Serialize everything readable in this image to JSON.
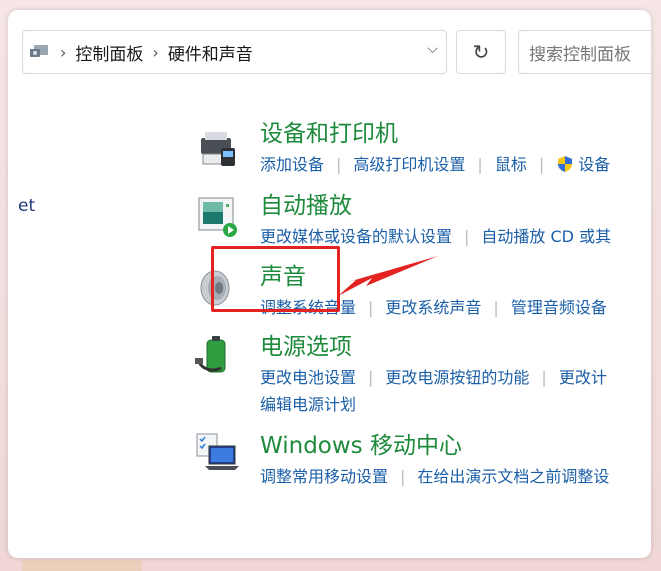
{
  "breadcrumb": {
    "part1": "控制面板",
    "part2": "硬件和声音"
  },
  "search": {
    "placeholder": "搜索控制面板"
  },
  "left_stub_text": "et",
  "categories": {
    "devices": {
      "title": "设备和打印机",
      "links": [
        "添加设备",
        "高级打印机设置",
        "鼠标",
        "设备"
      ]
    },
    "autoplay": {
      "title": "自动播放",
      "links": [
        "更改媒体或设备的默认设置",
        "自动播放 CD 或其"
      ]
    },
    "sound": {
      "title": "声音",
      "links": [
        "调整系统音量",
        "更改系统声音",
        "管理音频设备"
      ]
    },
    "power": {
      "title": "电源选项",
      "links": [
        "更改电池设置",
        "更改电源按钮的功能",
        "更改计",
        "编辑电源计划"
      ]
    },
    "mobility": {
      "title": "Windows 移动中心",
      "links": [
        "调整常用移动设置",
        "在给出演示文档之前调整设"
      ]
    }
  },
  "colors": {
    "title": "#1e8a3c",
    "link": "#1b5fa8",
    "highlight": "#e52222"
  }
}
